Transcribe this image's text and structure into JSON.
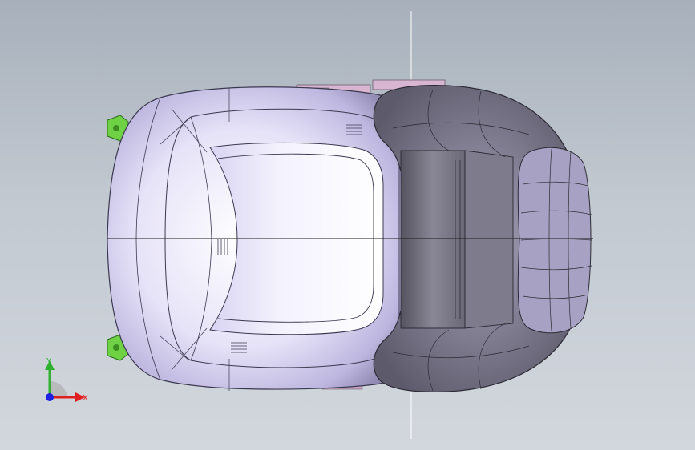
{
  "viewport": {
    "background_top": "#a7b0bb",
    "background_bottom": "#d2d7dd"
  },
  "model": {
    "body_color": "#e4e0f6",
    "body_shadow": "#9d97bd",
    "seat_color": "#6c6a78",
    "seat_shadow": "#403f4a",
    "bracket_color": "#d8b6d2",
    "clip_color": "#6fd245"
  },
  "triad": {
    "x_label": "X",
    "y_label": "Y",
    "x_color": "#e02020",
    "y_color": "#2fb02f",
    "z_color": "#2020e0"
  }
}
